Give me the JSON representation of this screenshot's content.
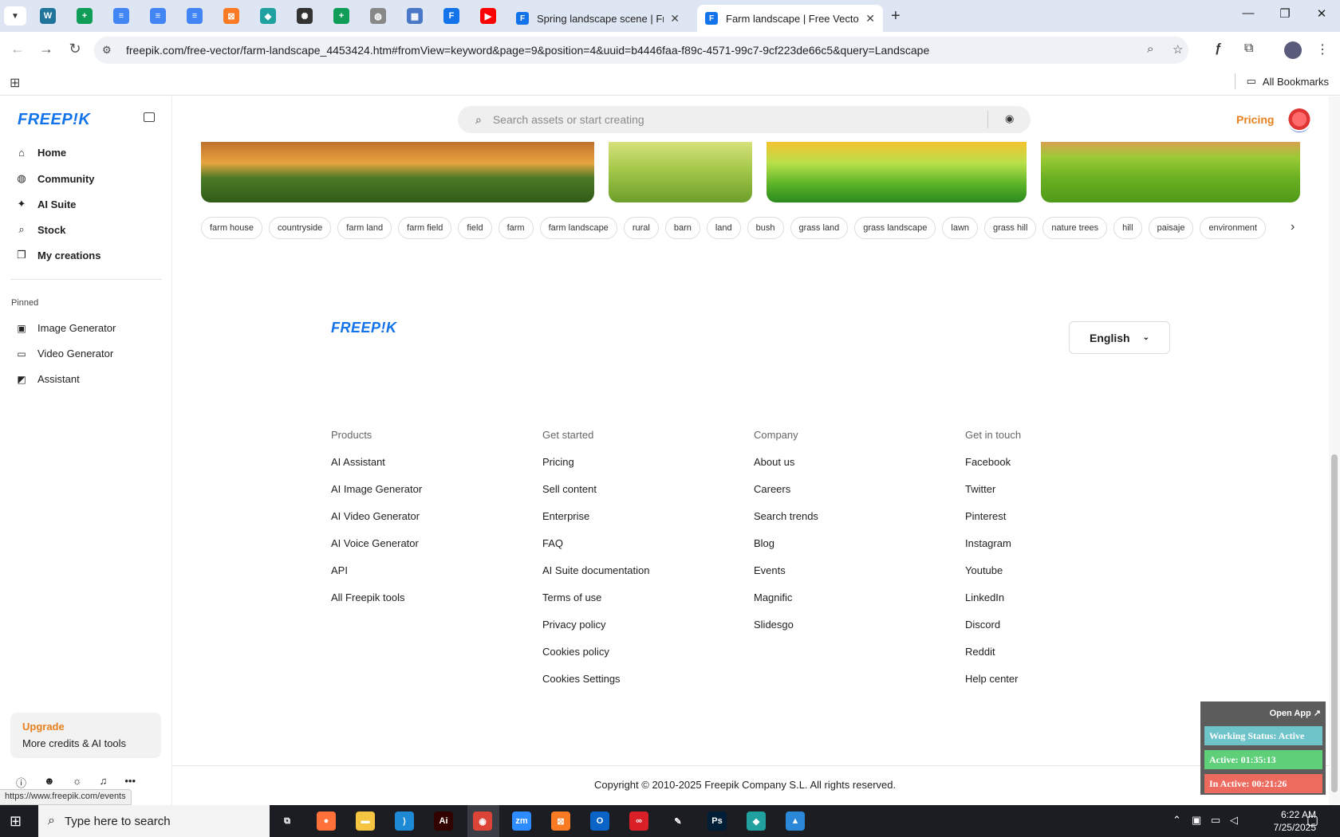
{
  "browser": {
    "pinned_tabs": [
      {
        "icon": "wordpress-icon",
        "color": "#21759b"
      },
      {
        "icon": "sheets-icon",
        "color": "#0f9d58"
      },
      {
        "icon": "docs-icon",
        "color": "#4285f4"
      },
      {
        "icon": "docs-icon",
        "color": "#4285f4"
      },
      {
        "icon": "docs-icon",
        "color": "#4285f4"
      },
      {
        "icon": "xampp-icon",
        "color": "#fb7a24"
      },
      {
        "icon": "app-icon",
        "color": "#21a0a0"
      },
      {
        "icon": "chatgpt-icon",
        "color": "#333333"
      },
      {
        "icon": "sheets-icon",
        "color": "#0f9d58"
      },
      {
        "icon": "globe-icon",
        "color": "#888888"
      },
      {
        "icon": "grid-icon",
        "color": "#4a78c7"
      },
      {
        "icon": "forms-icon",
        "color": "#1273eb"
      },
      {
        "icon": "youtube-icon",
        "color": "#ff0000"
      }
    ],
    "tabs": [
      {
        "title": "Spring landscape scene | Free Vector",
        "active": false
      },
      {
        "title": "Farm landscape | Free Vector",
        "active": true
      }
    ],
    "url": "freepik.com/free-vector/farm-landscape_4453424.htm#fromView=keyword&page=9&position=4&uuid=b4446faa-f89c-4571-99c7-9cf223de66c5&query=Landscape",
    "all_bookmarks": "All Bookmarks",
    "status_url": "https://www.freepik.com/events"
  },
  "sidebar": {
    "logo": "FREEP!K",
    "nav": [
      {
        "label": "Home",
        "icon": "home-icon",
        "glyph": "⌂"
      },
      {
        "label": "Community",
        "icon": "globe-icon",
        "glyph": "◍"
      },
      {
        "label": "AI Suite",
        "icon": "sparkle-icon",
        "glyph": "✦"
      },
      {
        "label": "Stock",
        "icon": "search-icon",
        "glyph": "⌕"
      },
      {
        "label": "My creations",
        "icon": "layers-icon",
        "glyph": "❐"
      }
    ],
    "pinned_label": "Pinned",
    "pinned": [
      {
        "label": "Image Generator",
        "icon": "image-icon",
        "glyph": "▣"
      },
      {
        "label": "Video Generator",
        "icon": "video-icon",
        "glyph": "▭"
      },
      {
        "label": "Assistant",
        "icon": "assistant-icon",
        "glyph": "◩"
      }
    ],
    "upgrade": {
      "title": "Upgrade",
      "subtitle": "More credits & AI tools"
    }
  },
  "header": {
    "search_placeholder": "Search assets or start creating",
    "pricing": "Pricing"
  },
  "tags": [
    "farm house",
    "countryside",
    "farm land",
    "farm field",
    "field",
    "farm",
    "farm landscape",
    "rural",
    "barn",
    "land",
    "bush",
    "grass land",
    "grass landscape",
    "lawn",
    "grass hill",
    "nature trees",
    "hill",
    "paisaje",
    "environment"
  ],
  "footer": {
    "logo": "FREEP!K",
    "language": "English",
    "columns": [
      {
        "heading": "Products",
        "links": [
          "AI Assistant",
          "AI Image Generator",
          "AI Video Generator",
          "AI Voice Generator",
          "API",
          "All Freepik tools"
        ]
      },
      {
        "heading": "Get started",
        "links": [
          "Pricing",
          "Sell content",
          "Enterprise",
          "FAQ",
          "AI Suite documentation",
          "Terms of use",
          "Privacy policy",
          "Cookies policy",
          "Cookies Settings"
        ]
      },
      {
        "heading": "Company",
        "links": [
          "About us",
          "Careers",
          "Search trends",
          "Blog",
          "Events",
          "Magnific",
          "Slidesgo"
        ]
      },
      {
        "heading": "Get in touch",
        "links": [
          "Facebook",
          "Twitter",
          "Pinterest",
          "Instagram",
          "Youtube",
          "LinkedIn",
          "Discord",
          "Reddit",
          "Help center"
        ]
      }
    ],
    "copyright": "Copyright © 2010-2025 Freepik Company S.L. All rights reserved."
  },
  "widget": {
    "open_app": "Open App ↗",
    "working_status": "Working Status: Active",
    "active": "Active: 01:35:13",
    "inactive": "In Active: 00:21:26",
    "colors": {
      "status": "#6fc4c9",
      "active": "#5fcf7a",
      "inactive": "#ec6a5e"
    }
  },
  "taskbar": {
    "search_placeholder": "Type here to search",
    "apps": [
      {
        "icon": "task-view-icon",
        "color": "#1b1d23",
        "glyph": "⧉"
      },
      {
        "icon": "firefox-icon",
        "color": "#ff7139",
        "glyph": "●"
      },
      {
        "icon": "file-explorer-icon",
        "color": "#f5c542",
        "glyph": "▬"
      },
      {
        "icon": "vscode-icon",
        "color": "#1e8ad6",
        "glyph": "⟩"
      },
      {
        "icon": "illustrator-icon",
        "color": "#330000",
        "glyph": "Ai"
      },
      {
        "icon": "chrome-icon",
        "color": "#db4437",
        "glyph": "◉"
      },
      {
        "icon": "zoom-icon",
        "color": "#2d8cff",
        "glyph": "zm"
      },
      {
        "icon": "xampp-icon",
        "color": "#fb7a24",
        "glyph": "⊠"
      },
      {
        "icon": "outlook-icon",
        "color": "#0a64c8",
        "glyph": "O"
      },
      {
        "icon": "creative-cloud-icon",
        "color": "#da1f26",
        "glyph": "∞"
      },
      {
        "icon": "pen-icon",
        "color": "#1b1d23",
        "glyph": "✎"
      },
      {
        "icon": "photoshop-icon",
        "color": "#001e36",
        "glyph": "Ps"
      },
      {
        "icon": "app-icon",
        "color": "#21a0a0",
        "glyph": "◆"
      },
      {
        "icon": "photos-icon",
        "color": "#2b88d8",
        "glyph": "▲"
      }
    ],
    "time": "6:22 AM",
    "date": "7/25/2025"
  }
}
